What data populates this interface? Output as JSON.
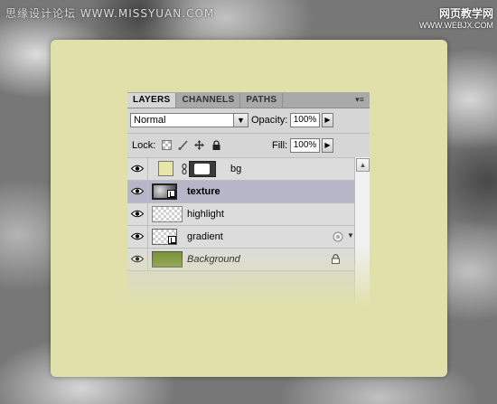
{
  "top_text": "思缘设计论坛  WWW.MISSYUAN.COM",
  "watermark": {
    "line1": "网页教学网",
    "line2": "WWW.WEBJX.COM"
  },
  "panel": {
    "tabs": [
      {
        "label": "LAYERS",
        "active": true
      },
      {
        "label": "CHANNELS",
        "active": false
      },
      {
        "label": "PATHS",
        "active": false
      }
    ],
    "menu_icon": "panel-menu-icon",
    "blend_mode": "Normal",
    "opacity_label": "Opacity:",
    "opacity_value": "100%",
    "lock_label": "Lock:",
    "lock_icons": [
      "lock-transparency-icon",
      "lock-brush-icon",
      "lock-move-icon",
      "lock-all-icon"
    ],
    "fill_label": "Fill:",
    "fill_value": "100%",
    "layers": [
      {
        "name": "bg",
        "type": "fill-with-mask",
        "fill_color": "#e6e6aa",
        "selected": false
      },
      {
        "name": "texture",
        "type": "smart-object",
        "selected": true
      },
      {
        "name": "highlight",
        "type": "pixel",
        "selected": false
      },
      {
        "name": "gradient",
        "type": "smart-object",
        "has_effects": true,
        "selected": false
      },
      {
        "name": "Background",
        "type": "background",
        "fill_color": "#6e8a2c",
        "locked": true,
        "selected": false
      }
    ]
  },
  "colors": {
    "card": "#e0e0aa",
    "panel": "#d6d6d6",
    "selected_row": "#b6b6c8"
  }
}
